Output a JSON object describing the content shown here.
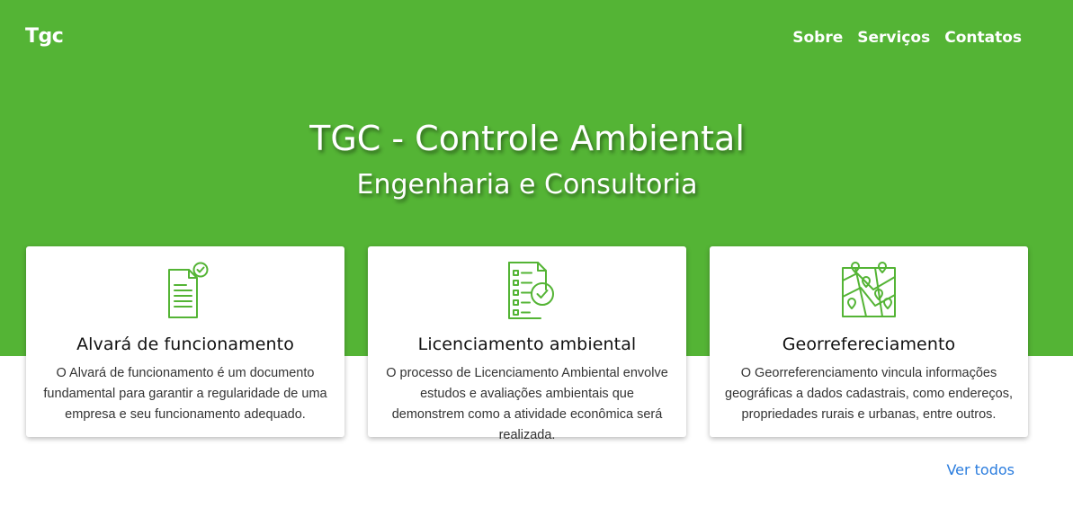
{
  "header": {
    "brand": "Tgc",
    "nav": [
      "Sobre",
      "Serviços",
      "Contatos"
    ]
  },
  "hero": {
    "title": "TGC - Controle Ambiental",
    "subtitle": "Engenharia e Consultoria"
  },
  "services": [
    {
      "icon": "document-check-icon",
      "title": "Alvará de funcionamento",
      "text": "O Alvará de funcionamento é um documento fundamental para garantir a regularidade de uma empresa e seu funcionamento adequado."
    },
    {
      "icon": "checklist-icon",
      "title": "Licenciamento ambiental",
      "text": "O processo de Licenciamento Ambiental envolve estudos e avaliações ambientais que demonstrem como a atividade econômica será realizada."
    },
    {
      "icon": "map-pins-icon",
      "title": "Georrefereciamento",
      "text": "O Georreferenciamento vincula informações geográficas a dados cadastrais, como endereços, propriedades rurais e urbanas, entre outros."
    }
  ],
  "links": {
    "ver_todos": "Ver todos"
  },
  "colors": {
    "primary": "#54b435",
    "link": "#2b7dde"
  }
}
